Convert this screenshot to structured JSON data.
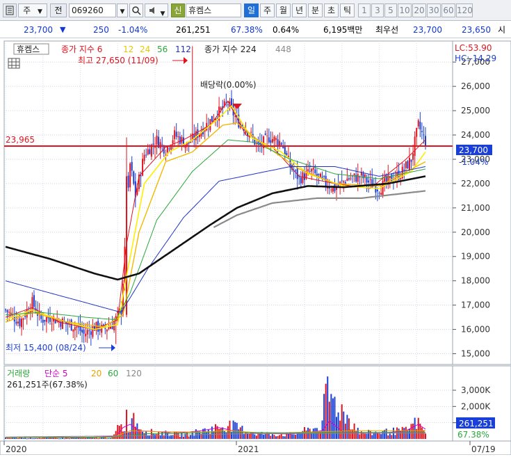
{
  "toolbar": {
    "menu_icon": "chart-menu-icon",
    "type_label": "주",
    "prefix_label": "전",
    "code_value": "069260",
    "search_icon": "search-icon",
    "sound_icon": "speaker-icon",
    "new_badge": "신",
    "name_value": "휴켐스",
    "periods": [
      "일",
      "주",
      "월",
      "년",
      "분",
      "초",
      "틱"
    ],
    "selected_period": "일",
    "intervals": [
      "1",
      "3",
      "5",
      "10",
      "20",
      "30",
      "60",
      "120"
    ]
  },
  "price_bar": {
    "price": "23,700",
    "direction_icon": "down-triangle-icon",
    "change": "250",
    "change_pct": "-1.04%",
    "volume": "261,251",
    "volume_pct": "67.38%",
    "turnover_pct": "0.64%",
    "amount": "6,195백만",
    "best_ask_label": "최우선",
    "best_ask": "23,700",
    "best_bid": "23,650",
    "market_suffix": "시"
  },
  "legend": {
    "stock_name": "휴켐스",
    "ma_label": "종가 지수 6",
    "ma_periods": [
      "12",
      "24",
      "56",
      "112"
    ],
    "ma2_label": "종가 지수 224",
    "ma2_extra": "448",
    "lc": "LC:53.90",
    "hc": "HC:-14.29"
  },
  "annotations": {
    "high": "최고 27,650 (11/09)",
    "low": "최저 15,400 (08/24)",
    "dividend": "배당락(0.00%)",
    "hline_value": "23,965",
    "last_price_tag": "23,700",
    "last_pct_tag": "-1.04%",
    "vol_last_tag": "261,251",
    "vol_pct_tag": "67.38%"
  },
  "volume_legend": {
    "label": "거래량",
    "type": "단순 5",
    "periods": [
      "20",
      "60",
      "120"
    ],
    "current": "261,251주(67.38%)"
  },
  "colors": {
    "up": "#e0141e",
    "down": "#1a3fd8",
    "ma6": "#e0141e",
    "ma12": "#ffee00",
    "ma24": "#f2b800",
    "ma56": "#2aa83a",
    "ma112": "#1f32c8",
    "ma224": "#111111",
    "ma448": "#8a8a8a"
  },
  "chart_data": {
    "type": "candlestick",
    "y_ticks": [
      "27,000",
      "26,000",
      "25,000",
      "24,000",
      "23,000",
      "22,000",
      "21,000",
      "20,000",
      "19,000",
      "18,000",
      "17,000",
      "16,000",
      "15,000"
    ],
    "ylim": [
      14700,
      27750
    ],
    "vol_ticks": [
      "3,000K",
      "2,000K",
      "1,000K"
    ],
    "vol_ylim": [
      0,
      3600
    ],
    "x_ticks": [
      "2020",
      "2021",
      "07/19"
    ],
    "series": [
      {
        "name": "종가",
        "anchors": [
          [
            0,
            16800
          ],
          [
            8,
            16300
          ],
          [
            15,
            17100
          ],
          [
            20,
            16400
          ],
          [
            25,
            16500
          ],
          [
            32,
            16300
          ],
          [
            40,
            16100
          ],
          [
            44,
            15800
          ],
          [
            50,
            16100
          ],
          [
            55,
            16000
          ],
          [
            60,
            16200
          ],
          [
            65,
            16800
          ],
          [
            70,
            22800
          ],
          [
            73,
            21500
          ],
          [
            78,
            23200
          ],
          [
            85,
            23800
          ],
          [
            90,
            23400
          ],
          [
            95,
            24000
          ],
          [
            102,
            23600
          ],
          [
            110,
            24200
          ],
          [
            118,
            24800
          ],
          [
            125,
            25300
          ],
          [
            130,
            24600
          ],
          [
            135,
            24300
          ],
          [
            142,
            23500
          ],
          [
            148,
            23900
          ],
          [
            155,
            23700
          ],
          [
            160,
            22700
          ],
          [
            165,
            22200
          ],
          [
            172,
            22500
          ],
          [
            178,
            22100
          ],
          [
            185,
            21800
          ],
          [
            192,
            22200
          ],
          [
            200,
            22300
          ],
          [
            205,
            22000
          ],
          [
            210,
            21800
          ],
          [
            215,
            22100
          ],
          [
            222,
            22400
          ],
          [
            228,
            23000
          ],
          [
            232,
            24400
          ],
          [
            236,
            23700
          ]
        ]
      },
      {
        "name": "6",
        "anchors": [
          [
            0,
            16500
          ],
          [
            15,
            16900
          ],
          [
            30,
            16300
          ],
          [
            50,
            16000
          ],
          [
            63,
            16400
          ],
          [
            68,
            19500
          ],
          [
            75,
            22300
          ],
          [
            90,
            23500
          ],
          [
            100,
            23800
          ],
          [
            115,
            24400
          ],
          [
            125,
            25400
          ],
          [
            135,
            24000
          ],
          [
            150,
            23500
          ],
          [
            165,
            22300
          ],
          [
            185,
            22000
          ],
          [
            205,
            21800
          ],
          [
            225,
            23000
          ],
          [
            236,
            23800
          ]
        ]
      },
      {
        "name": "12",
        "anchors": [
          [
            0,
            16400
          ],
          [
            15,
            16800
          ],
          [
            30,
            16400
          ],
          [
            50,
            16000
          ],
          [
            63,
            16200
          ],
          [
            68,
            18200
          ],
          [
            78,
            22000
          ],
          [
            92,
            23300
          ],
          [
            105,
            23800
          ],
          [
            120,
            24700
          ],
          [
            127,
            25200
          ],
          [
            138,
            23900
          ],
          [
            155,
            23300
          ],
          [
            170,
            22400
          ],
          [
            190,
            21900
          ],
          [
            210,
            21800
          ],
          [
            228,
            22500
          ],
          [
            236,
            23300
          ]
        ]
      },
      {
        "name": "24",
        "anchors": [
          [
            0,
            16300
          ],
          [
            15,
            16700
          ],
          [
            35,
            16300
          ],
          [
            55,
            16100
          ],
          [
            66,
            16600
          ],
          [
            75,
            20000
          ],
          [
            90,
            22900
          ],
          [
            105,
            23300
          ],
          [
            122,
            24400
          ],
          [
            130,
            24500
          ],
          [
            145,
            23600
          ],
          [
            165,
            22600
          ],
          [
            185,
            22000
          ],
          [
            210,
            21900
          ],
          [
            236,
            22900
          ]
        ]
      },
      {
        "name": "56",
        "anchors": [
          [
            0,
            16600
          ],
          [
            20,
            16700
          ],
          [
            45,
            16500
          ],
          [
            62,
            16400
          ],
          [
            70,
            17500
          ],
          [
            85,
            20500
          ],
          [
            105,
            22500
          ],
          [
            125,
            23800
          ],
          [
            140,
            23700
          ],
          [
            160,
            23000
          ],
          [
            185,
            22400
          ],
          [
            210,
            22200
          ],
          [
            236,
            22600
          ]
        ]
      },
      {
        "name": "112",
        "anchors": [
          [
            0,
            18000
          ],
          [
            25,
            17500
          ],
          [
            50,
            17000
          ],
          [
            65,
            16700
          ],
          [
            80,
            18500
          ],
          [
            100,
            20600
          ],
          [
            120,
            22100
          ],
          [
            140,
            22400
          ],
          [
            160,
            22700
          ],
          [
            185,
            22700
          ],
          [
            210,
            22300
          ],
          [
            236,
            22700
          ]
        ]
      },
      {
        "name": "224",
        "anchors": [
          [
            0,
            19400
          ],
          [
            25,
            18900
          ],
          [
            50,
            18300
          ],
          [
            63,
            18050
          ],
          [
            75,
            18300
          ],
          [
            95,
            19300
          ],
          [
            115,
            20300
          ],
          [
            130,
            21000
          ],
          [
            150,
            21600
          ],
          [
            170,
            21900
          ],
          [
            190,
            21850
          ],
          [
            215,
            22000
          ],
          [
            236,
            22300
          ]
        ]
      },
      {
        "name": "448",
        "anchors": [
          [
            117,
            20200
          ],
          [
            130,
            20700
          ],
          [
            150,
            21200
          ],
          [
            175,
            21400
          ],
          [
            200,
            21400
          ],
          [
            236,
            21700
          ]
        ]
      }
    ],
    "volume_anchors": [
      [
        0,
        80
      ],
      [
        30,
        60
      ],
      [
        60,
        90
      ],
      [
        64,
        900
      ],
      [
        68,
        700
      ],
      [
        72,
        1200
      ],
      [
        80,
        500
      ],
      [
        90,
        400
      ],
      [
        100,
        300
      ],
      [
        115,
        700
      ],
      [
        125,
        1000
      ],
      [
        140,
        400
      ],
      [
        160,
        300
      ],
      [
        178,
        900
      ],
      [
        180,
        3400
      ],
      [
        200,
        400
      ],
      [
        225,
        600
      ],
      [
        232,
        1300
      ],
      [
        236,
        300
      ]
    ],
    "markers": {
      "high_index": 105,
      "low_index": 62,
      "dividend_index": 133
    }
  }
}
